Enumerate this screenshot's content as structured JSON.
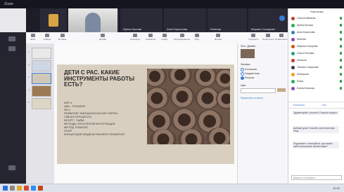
{
  "window": {
    "title": "Zoom"
  },
  "video_strip": {
    "tiles": [
      {
        "name": ""
      },
      {
        "name": ""
      },
      {
        "name": "Ирина Кулова"
      },
      {
        "name": "Анна Ермолова"
      },
      {
        "name": "Евгения"
      },
      {
        "name": "Марина Сахарова"
      }
    ]
  },
  "ribbon": {
    "buttons": [
      "Файл",
      "Главная",
      "Вставка",
      "Дизайн",
      "Переходы",
      "Анимация",
      "Слайд",
      "Рецензирование",
      "Вид",
      "Справка",
      "Формат",
      "Сохранить",
      "Поделиться",
      "Примечания"
    ]
  },
  "slides": {
    "numbers": [
      "1",
      "2",
      "3",
      "4",
      "5"
    ]
  },
  "slide": {
    "heading": "ДЕТИ С РАС. КАКИЕ ИНСТРУМЕНТЫ РАБОТЫ ЕСТЬ?",
    "body": "КОР-1\nАВА - ТЕРАПИЯ\nФЛ-1\nРАЗВИТИЕ ЭМОЦИОНАЛЬНОЙ СФЕРЫ\nСМЫСЛ ПРОЦЕССА\nФЛОРТ - ТАЙМ\nМЕТОДЫ СЕНСОРНОЙ ИНТЕГРАЦИИ\nМЕТОД ТОМАТИС\nSOAP\nКОНЦЕПЦИЯ МОДЕЛИ РАННЕГО РАЗВИТИЯ"
  },
  "design_panel": {
    "title": "Фон / Дизайн",
    "section_fill": "Заливка",
    "option_solid": "Сплошная",
    "option_gradient": "Градиентная",
    "option_picture": "Рисунок",
    "label_color": "Цвет",
    "apply_all": "Применить ко всем"
  },
  "chat": {
    "header": "Участники",
    "participants": [
      {
        "name": "Сергей Ивванов",
        "color": "#c0392b"
      },
      {
        "name": "Ирина Кулова",
        "color": "#27ae60"
      },
      {
        "name": "Анна Ермолова",
        "color": "#2980b9"
      },
      {
        "name": "Евгения",
        "color": "#8e44ad"
      },
      {
        "name": "Марина Сахарова",
        "color": "#d35400"
      },
      {
        "name": "Ольга Петрова",
        "color": "#16a085"
      },
      {
        "name": "Наталья",
        "color": "#c0392b"
      },
      {
        "name": "Татьяна Смирнова",
        "color": "#2c3e50"
      },
      {
        "name": "Екатерина",
        "color": "#f39c12"
      },
      {
        "name": "Юлия",
        "color": "#27ae60"
      },
      {
        "name": "Елена Волкова",
        "color": "#8e44ad"
      }
    ],
    "tab_people": "Участники",
    "tab_chat": "Чат",
    "messages": [
      "Здравствуйте, коллеги! Слышно хорошо.",
      "Добрый день! Спасибо за интересную тему.",
      "Подскажите, пожалуйста, где можно найти материалы презентации?"
    ],
    "input_placeholder": "Введите сообщение..."
  },
  "taskbar": {
    "time": "10:42"
  },
  "colors": {
    "accent": "#3a7bd5",
    "dark": "#15151d",
    "slide_bg": "#d8cfc0"
  }
}
